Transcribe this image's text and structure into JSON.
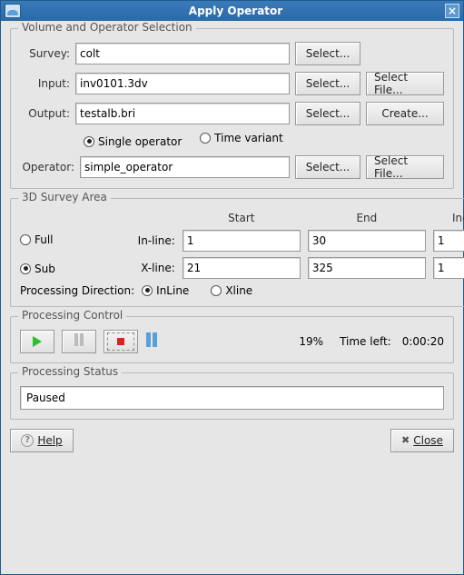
{
  "window": {
    "title": "Apply Operator"
  },
  "volume_section": {
    "legend": "Volume and Operator Selection",
    "survey_label": "Survey:",
    "survey_value": "colt",
    "input_label": "Input:",
    "input_value": "inv0101.3dv",
    "output_label": "Output:",
    "output_value": "testalb.bri",
    "operator_label": "Operator:",
    "operator_value": "simple_operator",
    "select_label": "Select...",
    "selectfile_label": "Select File...",
    "create_label": "Create...",
    "mode_single": "Single operator",
    "mode_timevariant": "Time variant"
  },
  "area_section": {
    "legend": "3D Survey Area",
    "full_label": "Full",
    "sub_label": "Sub",
    "start_hdr": "Start",
    "end_hdr": "End",
    "inc_hdr": "Inc",
    "inline_label": "In-line:",
    "xline_label": "X-line:",
    "inline_start": "1",
    "inline_end": "30",
    "inline_inc": "1",
    "xline_start": "21",
    "xline_end": "325",
    "xline_inc": "1",
    "procdir_label": "Processing Direction:",
    "procdir_inline": "InLine",
    "procdir_xline": "Xline"
  },
  "control_section": {
    "legend": "Processing Control",
    "percent": "19%",
    "timeleft_label": "Time left:",
    "timeleft_value": "0:00:20"
  },
  "status_section": {
    "legend": "Processing Status",
    "status_text": "Paused"
  },
  "buttons": {
    "help": "Help",
    "close": "Close"
  }
}
